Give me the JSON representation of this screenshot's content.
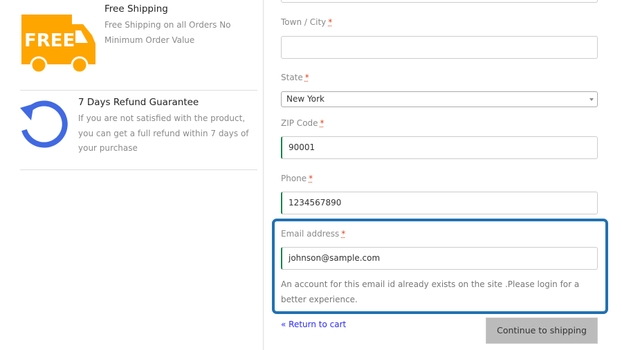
{
  "features": [
    {
      "title": "Free Shipping",
      "desc": "Free Shipping on all Orders No Minimum Order Value",
      "icon": "free-truck-icon",
      "icon_text": "FREE"
    },
    {
      "title": "7 Days Refund Guarantee",
      "desc": "If you are not satisfied with the product, you can get a full refund within 7 days of your purchase",
      "icon": "refund-icon"
    }
  ],
  "form": {
    "required_mark": "*",
    "town": {
      "label": "Town / City",
      "value": ""
    },
    "state": {
      "label": "State",
      "value": "New York"
    },
    "zip": {
      "label": "ZIP Code",
      "value": "90001"
    },
    "phone": {
      "label": "Phone",
      "value": "1234567890"
    },
    "email": {
      "label": "Email address",
      "value": "johnson@sample.com",
      "help": "An account for this email id already exists on the site .Please login for a better experience."
    }
  },
  "actions": {
    "return": "« Return to cart",
    "continue": "Continue to shipping"
  },
  "colors": {
    "truck": "#ffa500",
    "refund": "#4169e1",
    "highlight": "#2271b1"
  }
}
